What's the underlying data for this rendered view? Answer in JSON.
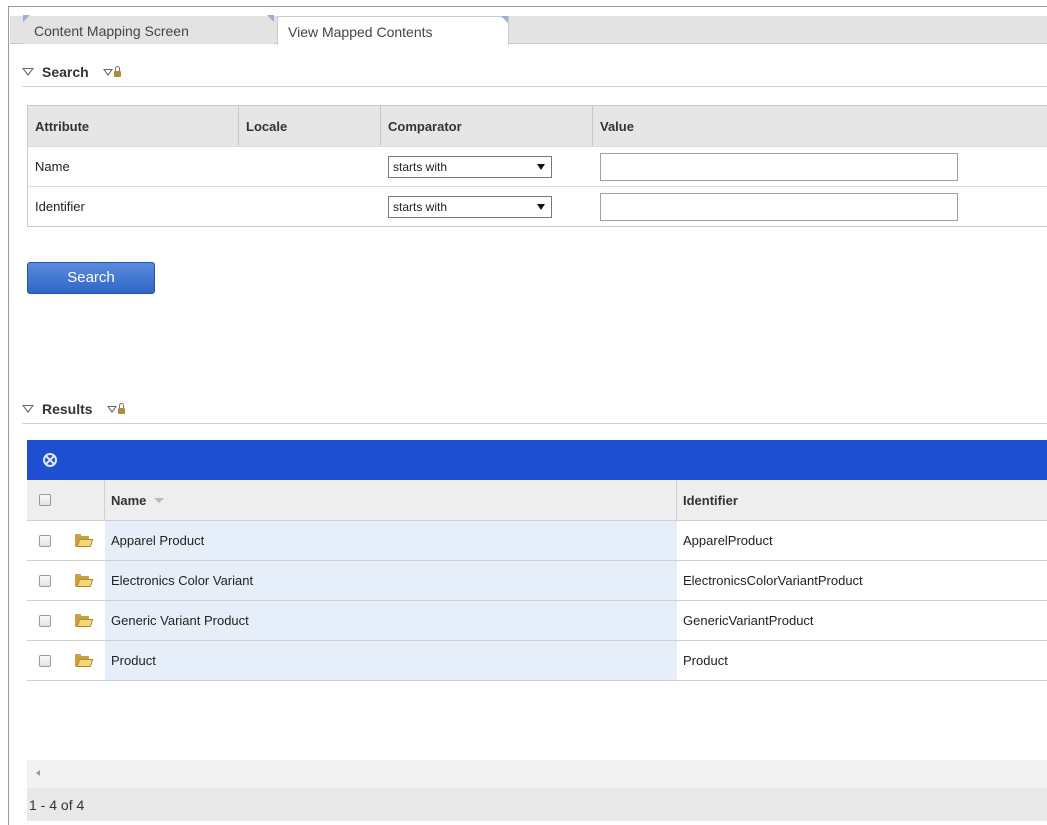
{
  "tabs": [
    {
      "label": "Content Mapping Screen"
    },
    {
      "label": "View Mapped Contents"
    }
  ],
  "search_section": {
    "title": "Search"
  },
  "search_table": {
    "headers": [
      "Attribute",
      "Locale",
      "Comparator",
      "Value"
    ],
    "rows": [
      {
        "attribute": "Name",
        "locale": "",
        "comparator": "starts with",
        "value": ""
      },
      {
        "attribute": "Identifier",
        "locale": "",
        "comparator": "starts with",
        "value": ""
      }
    ]
  },
  "search_button": {
    "label": "Search"
  },
  "results_section": {
    "title": "Results"
  },
  "results_grid": {
    "headers": {
      "name": "Name",
      "identifier": "Identifier"
    },
    "rows": [
      {
        "name": "Apparel Product",
        "identifier": "ApparelProduct"
      },
      {
        "name": "Electronics Color Variant",
        "identifier": "ElectronicsColorVariantProduct"
      },
      {
        "name": "Generic Variant Product",
        "identifier": "GenericVariantProduct"
      },
      {
        "name": "Product",
        "identifier": "Product"
      }
    ]
  },
  "pagination": {
    "text": "1 - 4 of 4"
  },
  "colors": {
    "toolbar": "#1e4fd1",
    "button": "#2f66c8",
    "row_highlight": "#e6eef9"
  }
}
